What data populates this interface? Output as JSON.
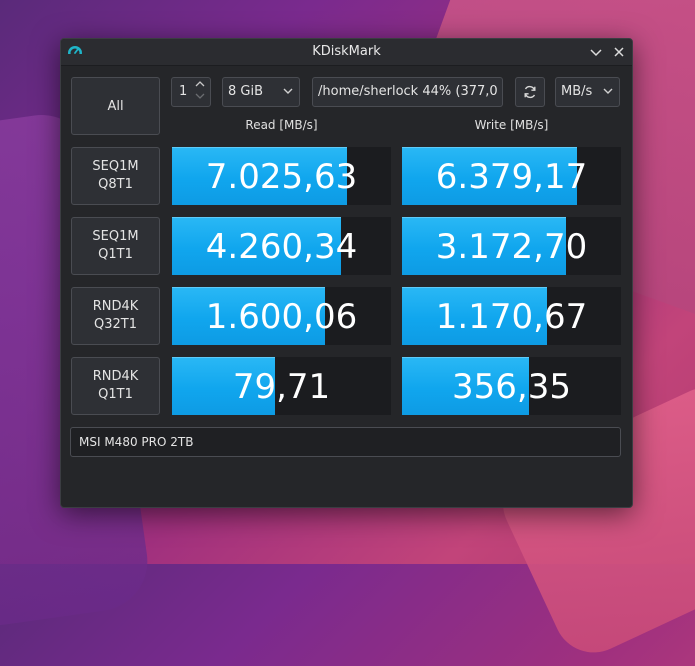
{
  "window": {
    "title": "KDiskMark"
  },
  "toolbar": {
    "all_label": "All",
    "loops_value": "1",
    "size_value": "8 GiB",
    "path_value": "/home/sherlock 44% (377,0",
    "unit_value": "MB/s"
  },
  "columns": {
    "read": "Read [MB/s]",
    "write": "Write [MB/s]"
  },
  "rows": [
    {
      "label_line1": "SEQ1M",
      "label_line2": "Q8T1",
      "read": "7.025,63",
      "write": "6.379,17",
      "read_fill": 0.8,
      "write_fill": 0.8
    },
    {
      "label_line1": "SEQ1M",
      "label_line2": "Q1T1",
      "read": "4.260,34",
      "write": "3.172,70",
      "read_fill": 0.77,
      "write_fill": 0.75
    },
    {
      "label_line1": "RND4K",
      "label_line2": "Q32T1",
      "read": "1.600,06",
      "write": "1.170,67",
      "read_fill": 0.7,
      "write_fill": 0.66
    },
    {
      "label_line1": "RND4K",
      "label_line2": "Q1T1",
      "read": "79,71",
      "write": "356,35",
      "read_fill": 0.47,
      "write_fill": 0.58
    }
  ],
  "device": {
    "model": "MSI M480 PRO 2TB"
  },
  "colors": {
    "bar": "#10a6ee",
    "window": "#252629"
  }
}
